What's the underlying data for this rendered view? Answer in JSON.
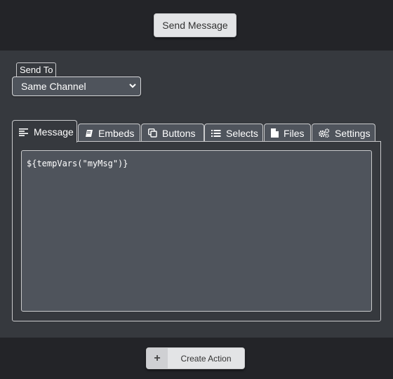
{
  "top": {
    "send_button_label": "Send Message"
  },
  "send_to": {
    "label": "Send To",
    "selected": "Same Channel"
  },
  "tabs": [
    {
      "label": "Message",
      "icon": "align-left-icon",
      "active": true
    },
    {
      "label": "Embeds",
      "icon": "book-icon",
      "active": false
    },
    {
      "label": "Buttons",
      "icon": "copy-icon",
      "active": false
    },
    {
      "label": "Selects",
      "icon": "list-icon",
      "active": false
    },
    {
      "label": "Files",
      "icon": "file-icon",
      "active": false
    },
    {
      "label": "Settings",
      "icon": "cogs-icon",
      "active": false
    }
  ],
  "editor": {
    "content": "${tempVars(\"myMsg\")}"
  },
  "footer": {
    "plus_symbol": "+",
    "create_label": "Create Action"
  },
  "colors": {
    "background_dark": "#232428",
    "panel": "#36393e",
    "field": "#4f545c",
    "button_light": "#e3e4e6"
  }
}
